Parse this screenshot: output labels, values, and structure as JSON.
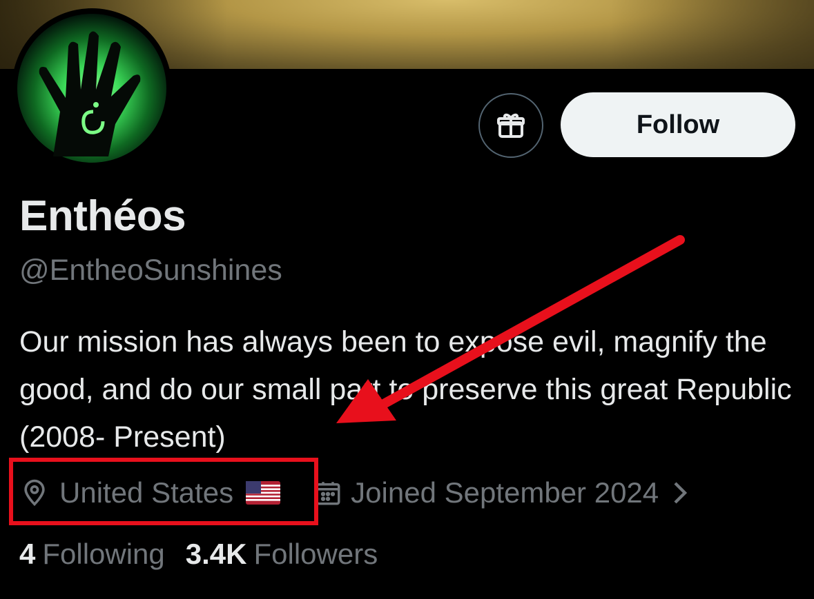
{
  "profile": {
    "display_name": "Enthéos",
    "handle": "@EntheoSunshines",
    "bio": "Our mission has always been to expose evil, magnify the good, and do our small part to preserve this great Republic (2008- Present)",
    "location": "United States",
    "joined": "Joined September 2024"
  },
  "actions": {
    "follow_label": "Follow",
    "gift_icon": "gift-icon"
  },
  "stats": {
    "following_count": "4",
    "following_label": "Following",
    "followers_count": "3.4K",
    "followers_label": "Followers"
  },
  "icons": {
    "location": "location-pin-icon",
    "calendar": "calendar-icon",
    "chevron": "chevron-right-icon",
    "flag": "us-flag-icon"
  },
  "colors": {
    "background": "#000000",
    "primary_text": "#e7e9ea",
    "secondary_text": "#71767b",
    "follow_button_bg": "#eff3f4",
    "annotation_red": "#e8101c",
    "avatar_glow": "#3ddc5a"
  }
}
